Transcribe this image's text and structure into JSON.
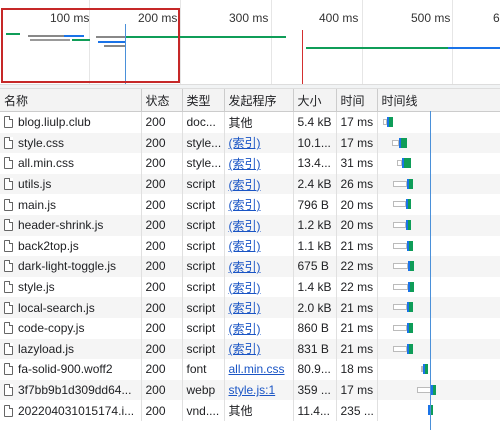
{
  "overview": {
    "ticks": [
      "100 ms",
      "200 ms",
      "300 ms",
      "400 ms",
      "500 ms",
      "6"
    ]
  },
  "columns": {
    "name": "名称",
    "status": "状态",
    "type": "类型",
    "initiator": "发起程序",
    "size": "大小",
    "time": "时间",
    "waterfall": "时间线"
  },
  "rows": [
    {
      "name": "blog.liulp.club",
      "status": "200",
      "type": "doc...",
      "initiator": "其他",
      "initiator_link": false,
      "size": "5.4 kB",
      "time": "17 ms"
    },
    {
      "name": "style.css",
      "status": "200",
      "type": "style...",
      "initiator": "(索引)",
      "initiator_link": true,
      "size": "10.1...",
      "time": "17 ms"
    },
    {
      "name": "all.min.css",
      "status": "200",
      "type": "style...",
      "initiator": "(索引)",
      "initiator_link": true,
      "size": "13.4...",
      "time": "31 ms"
    },
    {
      "name": "utils.js",
      "status": "200",
      "type": "script",
      "initiator": "(索引)",
      "initiator_link": true,
      "size": "2.4 kB",
      "time": "26 ms"
    },
    {
      "name": "main.js",
      "status": "200",
      "type": "script",
      "initiator": "(索引)",
      "initiator_link": true,
      "size": "796 B",
      "time": "20 ms"
    },
    {
      "name": "header-shrink.js",
      "status": "200",
      "type": "script",
      "initiator": "(索引)",
      "initiator_link": true,
      "size": "1.2 kB",
      "time": "20 ms"
    },
    {
      "name": "back2top.js",
      "status": "200",
      "type": "script",
      "initiator": "(索引)",
      "initiator_link": true,
      "size": "1.1 kB",
      "time": "21 ms"
    },
    {
      "name": "dark-light-toggle.js",
      "status": "200",
      "type": "script",
      "initiator": "(索引)",
      "initiator_link": true,
      "size": "675 B",
      "time": "22 ms"
    },
    {
      "name": "style.js",
      "status": "200",
      "type": "script",
      "initiator": "(索引)",
      "initiator_link": true,
      "size": "1.4 kB",
      "time": "22 ms"
    },
    {
      "name": "local-search.js",
      "status": "200",
      "type": "script",
      "initiator": "(索引)",
      "initiator_link": true,
      "size": "2.0 kB",
      "time": "21 ms"
    },
    {
      "name": "code-copy.js",
      "status": "200",
      "type": "script",
      "initiator": "(索引)",
      "initiator_link": true,
      "size": "860 B",
      "time": "21 ms"
    },
    {
      "name": "lazyload.js",
      "status": "200",
      "type": "script",
      "initiator": "(索引)",
      "initiator_link": true,
      "size": "831 B",
      "time": "21 ms"
    },
    {
      "name": "fa-solid-900.woff2",
      "status": "200",
      "type": "font",
      "initiator": "all.min.css",
      "initiator_link": true,
      "size": "80.9...",
      "time": "18 ms"
    },
    {
      "name": "3f7bb9b1d309dd64...",
      "status": "200",
      "type": "webp",
      "initiator": "style.js:1",
      "initiator_link": true,
      "size": "359 ...",
      "time": "17 ms"
    },
    {
      "name": "202204031015174.i...",
      "status": "200",
      "type": "vnd....",
      "initiator": "其他",
      "initiator_link": false,
      "size": "11.4...",
      "time": "235 ..."
    }
  ],
  "colors": {
    "waiting": "#ffffff",
    "download": "#0f9d58",
    "ttfb": "#1a73e8",
    "selection": "#c62828",
    "load_line": "#4a90d9",
    "dom_line": "#d32f2f"
  }
}
